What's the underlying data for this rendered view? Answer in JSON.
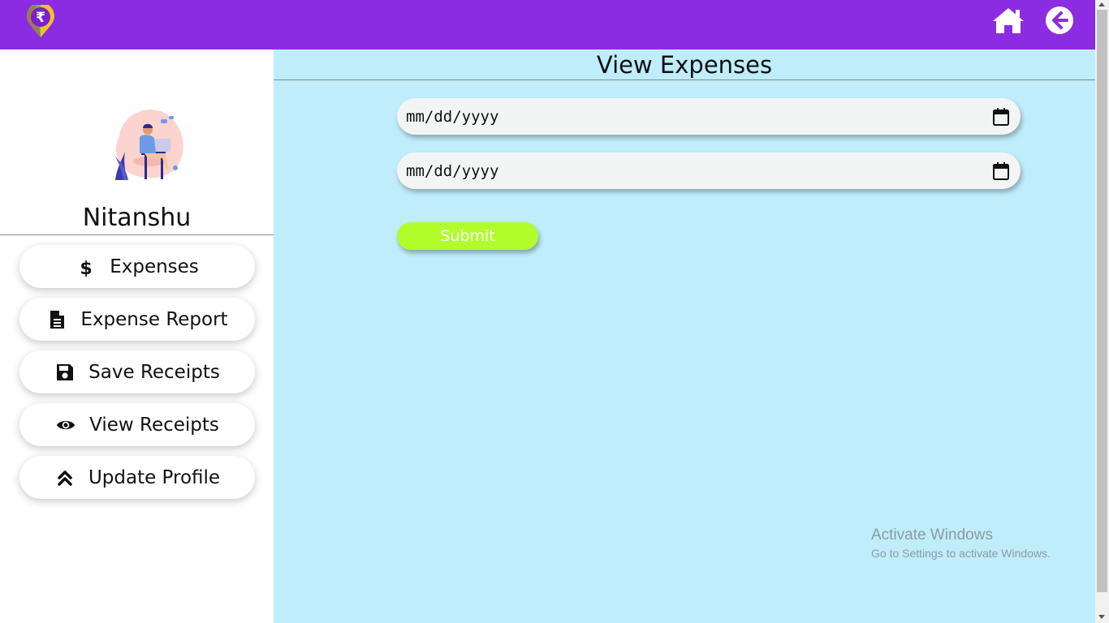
{
  "header": {
    "logo_icon": "rupee-pin-logo",
    "home_icon": "home-icon",
    "back_icon": "arrow-circle-left-icon",
    "background_color": "#8b2be2"
  },
  "sidebar": {
    "avatar_icon": "person-at-laptop-illustration",
    "username": "Nitanshu",
    "items": [
      {
        "label": "Expenses",
        "icon": "dollar-icon"
      },
      {
        "label": "Expense Report",
        "icon": "file-text-icon"
      },
      {
        "label": "Save Receipts",
        "icon": "floppy-disk-icon"
      },
      {
        "label": "View Receipts",
        "icon": "eye-icon"
      },
      {
        "label": "Update Profile",
        "icon": "double-chevron-up-icon"
      }
    ]
  },
  "main": {
    "title": "View Expenses",
    "background_color": "#bfedfb",
    "date_from": {
      "placeholder": "mm/dd/yyyy",
      "icon": "calendar-icon"
    },
    "date_to": {
      "placeholder": "mm/dd/yyyy",
      "icon": "calendar-icon"
    },
    "submit_label": "Submit",
    "submit_color": "#b0fd2b"
  },
  "watermark": {
    "line1": "Activate Windows",
    "line2": "Go to Settings to activate Windows."
  }
}
